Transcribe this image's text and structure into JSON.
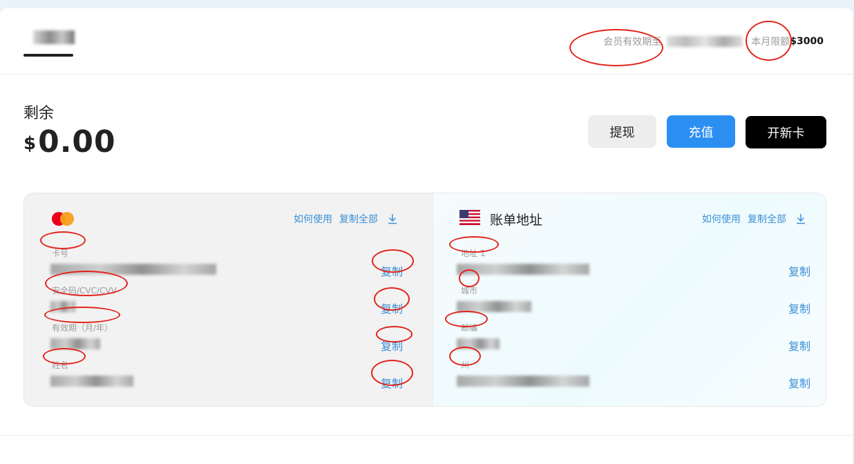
{
  "header": {
    "tab_label": "",
    "membership_label": "会员有效期至",
    "limit_label": "本月限额",
    "limit_value": "$3000"
  },
  "balance": {
    "label": "剩余",
    "currency": "$",
    "amount": "0.00"
  },
  "actions": {
    "withdraw": "提现",
    "recharge": "充值",
    "new_card": "开新卡"
  },
  "card": {
    "how_to_use": "如何使用",
    "copy_all": "复制全部",
    "fields": [
      {
        "label": "卡号",
        "copy": "复制"
      },
      {
        "label": "安全码/CVC/CVV",
        "copy": "复制"
      },
      {
        "label": "有效期（月/年）",
        "copy": "复制"
      },
      {
        "label": "姓名",
        "copy": "复制"
      }
    ]
  },
  "billing": {
    "title": "账单地址",
    "how_to_use": "如何使用",
    "copy_all": "复制全部",
    "fields": [
      {
        "label": "地址 1",
        "copy": "复制"
      },
      {
        "label": "城市",
        "copy": "复制"
      },
      {
        "label": "邮编",
        "copy": "复制"
      },
      {
        "label": "州",
        "copy": "复制"
      }
    ]
  },
  "colors": {
    "accent": "#2b8ff2",
    "link": "#3a8fd6",
    "annotation": "#e2231a"
  },
  "icons": [
    "mastercard-logo-icon",
    "us-flag-icon",
    "download-icon"
  ]
}
